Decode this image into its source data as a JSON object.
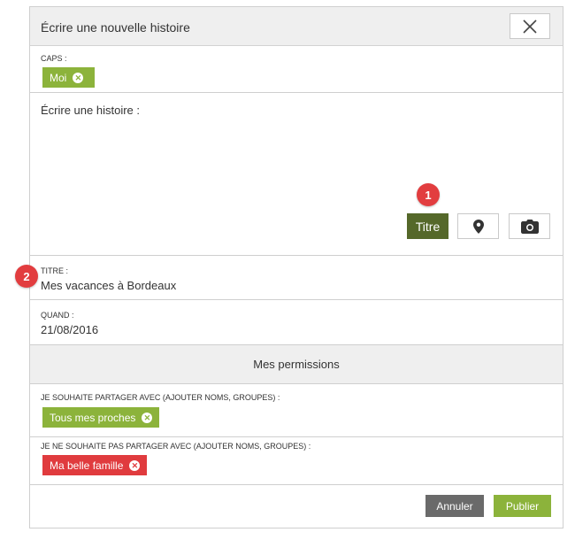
{
  "dialog": {
    "title": "Écrire une nouvelle histoire",
    "close_icon": "close-icon"
  },
  "caps": {
    "label": "CAPS :",
    "chips": [
      {
        "label": "Moi",
        "remove_icon": "remove-icon"
      }
    ]
  },
  "story": {
    "label": "Écrire une histoire :",
    "toolbar": {
      "titre_label": "Titre",
      "location_icon": "map-pin-icon",
      "camera_icon": "camera-icon"
    }
  },
  "annotations": {
    "badge_1": "1",
    "badge_2": "2",
    "badge_color": "#e23d3f"
  },
  "titre": {
    "label": "TITRE :",
    "value": "Mes vacances à Bordeaux"
  },
  "quand": {
    "label": "QUAND :",
    "value": "21/08/2016"
  },
  "permissions": {
    "header": "Mes permissions",
    "share_label": "JE SOUHAITE PARTAGER AVEC (AJOUTER NOMS, GROUPES) :",
    "share_chips": [
      {
        "label": "Tous mes proches"
      }
    ],
    "noshare_label": "JE NE SOUHAITE PAS PARTAGER AVEC (AJOUTER NOMS, GROUPES) :",
    "noshare_chips": [
      {
        "label": "Ma belle famille"
      }
    ]
  },
  "footer": {
    "cancel_label": "Annuler",
    "publish_label": "Publier"
  },
  "colors": {
    "accent_green": "#8cb33b",
    "dark_green": "#55682a",
    "red": "#e03b3e",
    "gray_button": "#6a6a6a"
  }
}
